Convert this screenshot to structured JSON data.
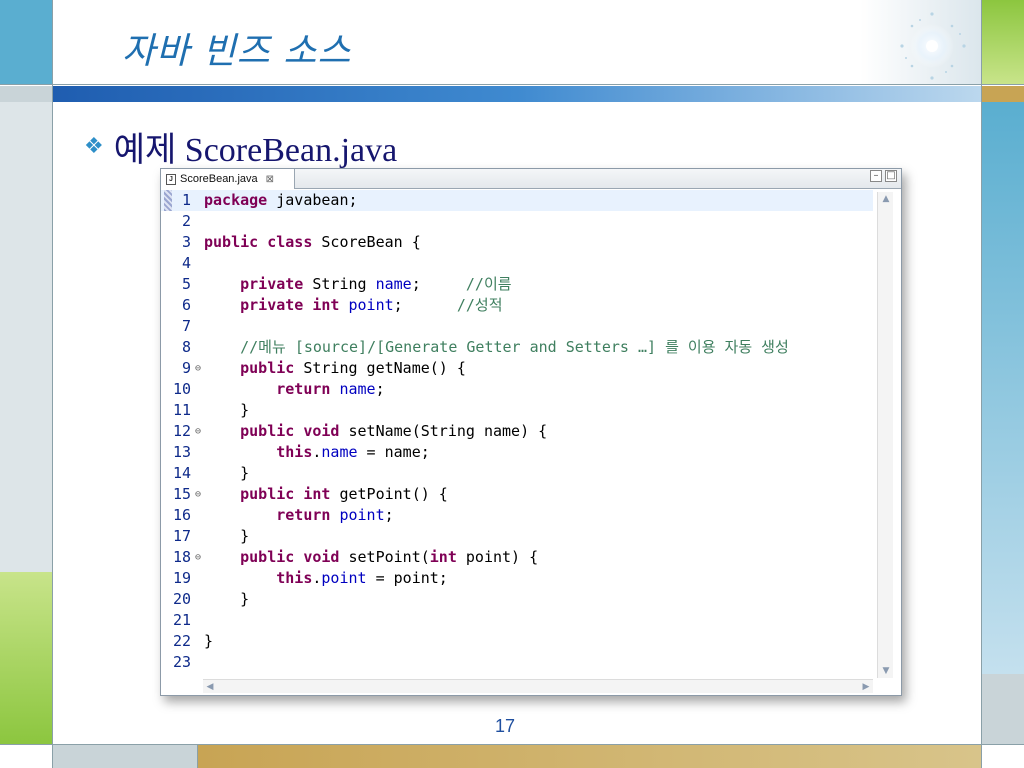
{
  "slide": {
    "title": "자바 빈즈 소스",
    "bullet_icon": "diamond-cluster-icon",
    "bullet_text": "예제 ScoreBean.java",
    "page_number": "17"
  },
  "editor": {
    "tab_label": "ScoreBean.java",
    "tab_icon": "java-file-icon",
    "tab_close": "⊠",
    "minimize": "▭",
    "maximize": "□",
    "lines": [
      {
        "n": "1",
        "fold": "",
        "html": "<span class=\"kw\">package</span> javabean;"
      },
      {
        "n": "2",
        "fold": "",
        "html": ""
      },
      {
        "n": "3",
        "fold": "",
        "html": "<span class=\"kw\">public</span> <span class=\"kw\">class</span> ScoreBean {"
      },
      {
        "n": "4",
        "fold": "",
        "html": ""
      },
      {
        "n": "5",
        "fold": "",
        "html": "    <span class=\"kw\">private</span> String <span class=\"fld\">name</span>;     <span class=\"cm\">//이름</span>"
      },
      {
        "n": "6",
        "fold": "",
        "html": "    <span class=\"kw\">private</span> <span class=\"kw\">int</span> <span class=\"fld\">point</span>;      <span class=\"cm\">//성적</span>"
      },
      {
        "n": "7",
        "fold": "",
        "html": ""
      },
      {
        "n": "8",
        "fold": "",
        "html": "    <span class=\"cm\">//메뉴 [source]/[Generate Getter and Setters …] 를 이용 자동 생성</span>"
      },
      {
        "n": "9",
        "fold": "⊖",
        "html": "    <span class=\"kw\">public</span> String getName() {"
      },
      {
        "n": "10",
        "fold": "",
        "html": "        <span class=\"kw\">return</span> <span class=\"fld\">name</span>;"
      },
      {
        "n": "11",
        "fold": "",
        "html": "    }"
      },
      {
        "n": "12",
        "fold": "⊖",
        "html": "    <span class=\"kw\">public</span> <span class=\"kw\">void</span> setName(String name) {"
      },
      {
        "n": "13",
        "fold": "",
        "html": "        <span class=\"kw\">this</span>.<span class=\"fld\">name</span> = name;"
      },
      {
        "n": "14",
        "fold": "",
        "html": "    }"
      },
      {
        "n": "15",
        "fold": "⊖",
        "html": "    <span class=\"kw\">public</span> <span class=\"kw\">int</span> getPoint() {"
      },
      {
        "n": "16",
        "fold": "",
        "html": "        <span class=\"kw\">return</span> <span class=\"fld\">point</span>;"
      },
      {
        "n": "17",
        "fold": "",
        "html": "    }"
      },
      {
        "n": "18",
        "fold": "⊖",
        "html": "    <span class=\"kw\">public</span> <span class=\"kw\">void</span> setPoint(<span class=\"kw\">int</span> point) {"
      },
      {
        "n": "19",
        "fold": "",
        "html": "        <span class=\"kw\">this</span>.<span class=\"fld\">point</span> = point;"
      },
      {
        "n": "20",
        "fold": "",
        "html": "    }"
      },
      {
        "n": "21",
        "fold": "",
        "html": ""
      },
      {
        "n": "22",
        "fold": "",
        "html": "}"
      },
      {
        "n": "23",
        "fold": "",
        "html": ""
      }
    ],
    "current_line": "1"
  }
}
